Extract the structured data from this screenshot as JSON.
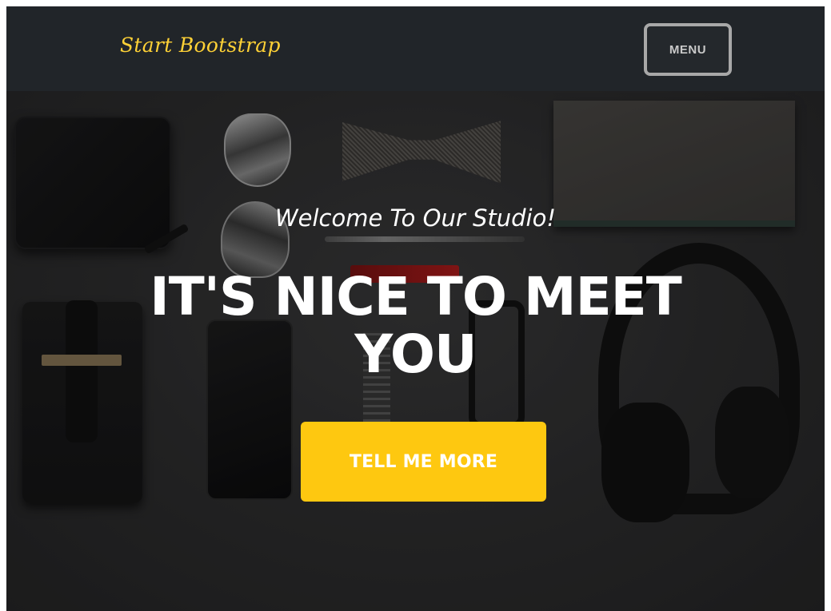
{
  "navbar": {
    "brand": "Start Bootstrap",
    "menu_label": "MENU"
  },
  "hero": {
    "subtitle": "Welcome To Our Studio!",
    "heading": "IT'S NICE TO MEET YOU",
    "cta_label": "TELL ME MORE"
  },
  "colors": {
    "brand": "#fed136",
    "navbar_bg": "#212529",
    "cta_bg": "#fec810",
    "menu_border": "#a8a8a8"
  },
  "icons": {
    "background": "hero-background-image"
  }
}
